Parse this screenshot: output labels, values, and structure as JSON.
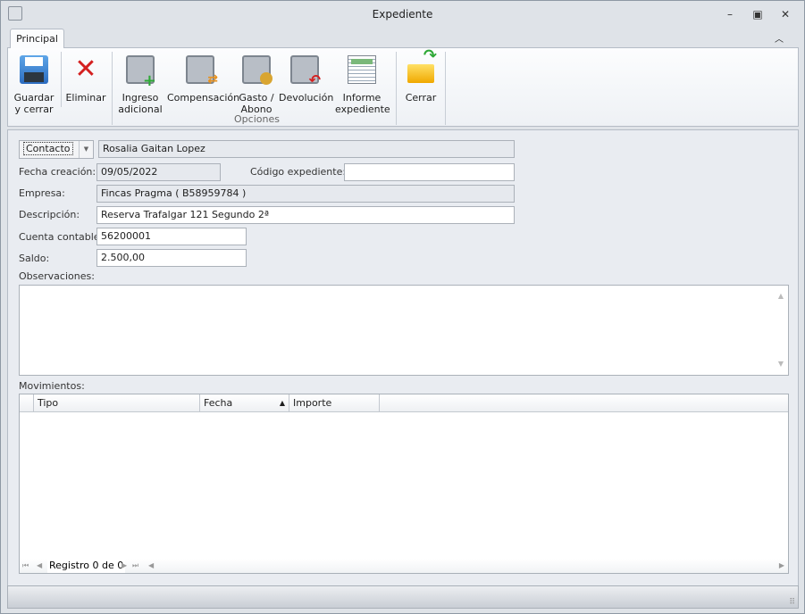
{
  "window": {
    "title": "Expediente"
  },
  "tabs": [
    {
      "label": "Principal"
    }
  ],
  "ribbon": {
    "save": "Guardar\ny cerrar",
    "delete": "Eliminar",
    "extra_income": "Ingreso\nadicional",
    "compensation": "Compensación",
    "expense": "Gasto /\nAbono",
    "refund": "Devolución",
    "report": "Informe\nexpediente",
    "close": "Cerrar",
    "group_options": "Opciones"
  },
  "form": {
    "contact_type": "Contacto",
    "contact_value": "Rosalia Gaitan Lopez",
    "created_label": "Fecha creación:",
    "created_value": "09/05/2022",
    "code_label": "Código expediente:",
    "code_value": "",
    "company_label": "Empresa:",
    "company_value": "Fincas Pragma ( B58959784 )",
    "description_label": "Descripción:",
    "description_value": "Reserva Trafalgar 121 Segundo 2ª",
    "account_label": "Cuenta contable:",
    "account_value": "56200001",
    "balance_label": "Saldo:",
    "balance_value": "2.500,00",
    "notes_label": "Observaciones:",
    "movements_label": "Movimientos:"
  },
  "grid": {
    "columns": [
      "Tipo",
      "Fecha",
      "Importe"
    ],
    "nav_text": "Registro 0 de 0"
  }
}
